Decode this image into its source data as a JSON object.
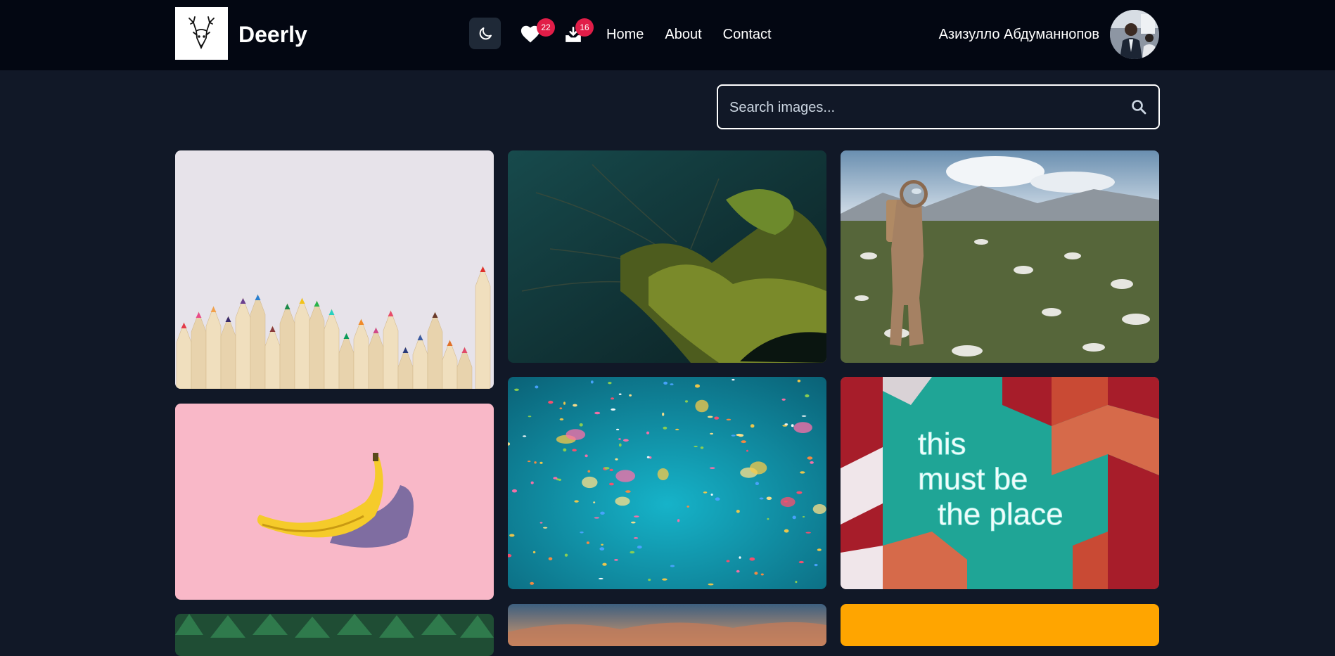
{
  "brand": {
    "name": "Deerly",
    "logo_icon": "deer-head-icon"
  },
  "header": {
    "theme_toggle_icon": "moon-icon",
    "favorites": {
      "icon": "heart-icon",
      "count": "22"
    },
    "downloads": {
      "icon": "download-tray-icon",
      "count": "16"
    },
    "nav": [
      {
        "label": "Home"
      },
      {
        "label": "About"
      },
      {
        "label": "Contact"
      }
    ],
    "user": {
      "name": "Азизулло Абдуманнопов",
      "avatar": "user-avatar"
    }
  },
  "search": {
    "placeholder": "Search images...",
    "value": "",
    "icon": "search-icon"
  },
  "gallery": {
    "images": [
      {
        "subject": "colored-pencils",
        "column": 1
      },
      {
        "subject": "banana-on-pink",
        "column": 1
      },
      {
        "subject": "green-forest",
        "column": 1
      },
      {
        "subject": "plants-in-water",
        "column": 2
      },
      {
        "subject": "confetti-on-teal",
        "column": 2
      },
      {
        "subject": "sunset-clouds",
        "column": 2
      },
      {
        "subject": "astronaut-in-meadow",
        "column": 3
      },
      {
        "subject": "neon-sign",
        "column": 3,
        "text": [
          "this",
          "must be",
          "the place"
        ]
      },
      {
        "subject": "orange-backdrop",
        "column": 3
      }
    ]
  },
  "colors": {
    "background": "#111827",
    "navbar": "#030712",
    "toggle_bg": "#1f2937",
    "badge": "#e11d48",
    "accent_orange": "#ffa500"
  }
}
